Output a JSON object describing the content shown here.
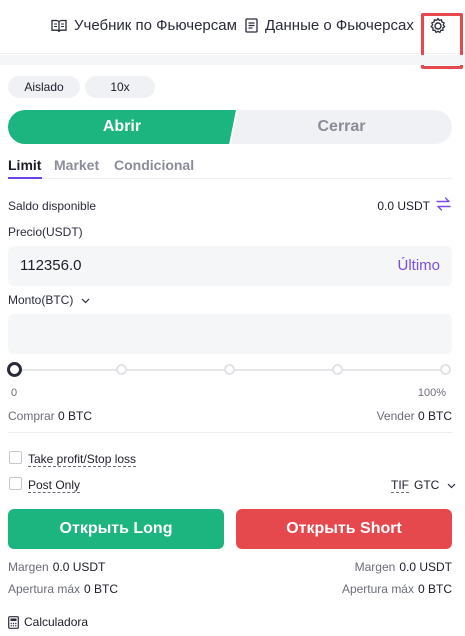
{
  "header": {
    "tutorial_label": "Учебник по Фьючерсам",
    "data_label": "Данные о Фьючерсах"
  },
  "margin_mode": "Aislado",
  "leverage": "10x",
  "side_toggle": {
    "open_label": "Abrir",
    "close_label": "Cerrar",
    "selected": "Abrir"
  },
  "order_tabs": {
    "limit": "Limit",
    "market": "Market",
    "conditional": "Condicional",
    "selected": "Limit"
  },
  "balance": {
    "label": "Saldo disponible",
    "value": "0.0 USDT"
  },
  "price": {
    "label": "Precio(USDT)",
    "value": "112356.0",
    "last_label": "Último"
  },
  "amount": {
    "label": "Monto(BTC)",
    "value": ""
  },
  "slider": {
    "min_label": "0",
    "max_label": "100%",
    "percent": 0
  },
  "buy": {
    "label": "Comprar",
    "value": "0 BTC"
  },
  "sell": {
    "label": "Vender",
    "value": "0 BTC"
  },
  "options": {
    "tpsl_label": "Take profit/Stop loss",
    "post_only_label": "Post Only"
  },
  "tif": {
    "label": "TIF",
    "value": "GTC"
  },
  "actions": {
    "long_label": "Открыть Long",
    "short_label": "Открыть Short"
  },
  "long_info": {
    "margin_label": "Margen",
    "margin_value": "0.0 USDT",
    "max_open_label": "Apertura máx",
    "max_open_value": "0 BTC"
  },
  "short_info": {
    "margin_label": "Margen",
    "margin_value": "0.0 USDT",
    "max_open_label": "Apertura máx",
    "max_open_value": "0 BTC"
  },
  "calculator_label": "Calculadora",
  "colors": {
    "buy": "#1cb47f",
    "sell": "#e5484d",
    "accent": "#7a4de8"
  }
}
